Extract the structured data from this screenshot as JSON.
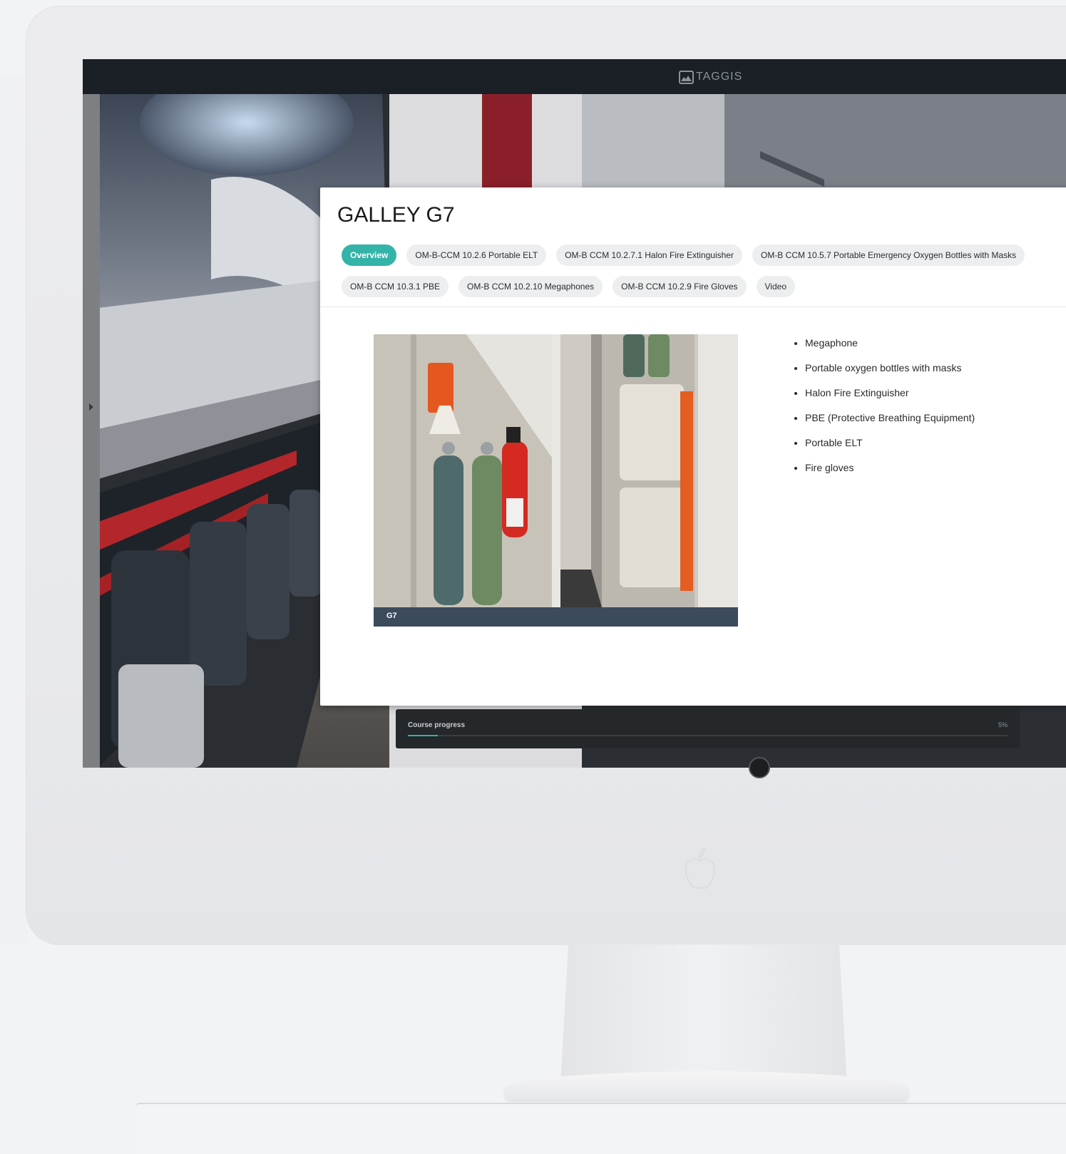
{
  "app": {
    "brand_name": "TAGGIS"
  },
  "panel": {
    "title": "GALLEY G7",
    "tabs_row1": [
      {
        "label": "Overview",
        "active": true
      },
      {
        "label": "OM-B-CCM 10.2.6 Portable ELT",
        "active": false
      },
      {
        "label": "OM-B CCM 10.2.7.1 Halon Fire Extinguisher",
        "active": false
      },
      {
        "label": "OM-B CCM 10.5.7 Portable Emergency Oxygen Bottles with Masks",
        "active": false
      }
    ],
    "tabs_row2": [
      {
        "label": "OM-B CCM 10.3.1 PBE",
        "active": false
      },
      {
        "label": "OM-B CCM 10.2.10 Megaphones",
        "active": false
      },
      {
        "label": "OM-B CCM 10.2.9 Fire Gloves",
        "active": false
      },
      {
        "label": "Video",
        "active": false
      }
    ],
    "image_caption": "G7",
    "equipment_list": [
      "Megaphone",
      "Portable oxygen bottles with masks",
      "Halon Fire Extinguisher",
      "PBE (Protective Breathing Equipment)",
      "Portable ELT",
      "Fire gloves"
    ]
  },
  "progress": {
    "label": "Course progress",
    "percent_text": "5%",
    "fraction": 0.05
  },
  "colors": {
    "accent": "#34b3a9",
    "topbar": "#1b2026",
    "caption_bar": "#3c4b5c"
  },
  "icons": {
    "brand_logo": "taggis-logo-icon",
    "side_toggle": "chevron-right-icon",
    "apple_logo": "apple-icon"
  }
}
